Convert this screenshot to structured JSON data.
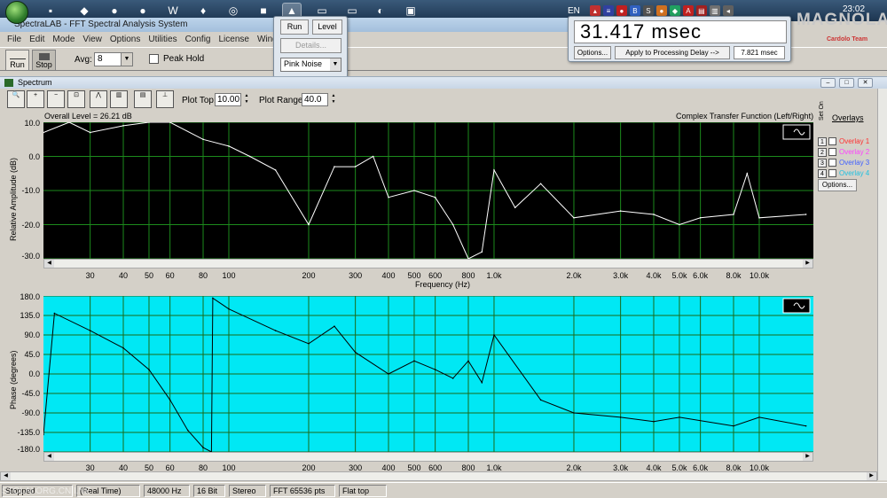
{
  "taskbar": {
    "clock": "23:02",
    "lang": "EN"
  },
  "brand": {
    "main": "MAGNOLA",
    "sub": "Cardolo Team"
  },
  "window": {
    "title": "SpectraLAB - FFT Spectral Analysis System"
  },
  "menu": [
    "File",
    "Edit",
    "Mode",
    "View",
    "Options",
    "Utilities",
    "Config",
    "License",
    "Window"
  ],
  "toolbar": {
    "run": "Run",
    "stop": "Stop",
    "avg_label": "Avg:",
    "avg_value": "8",
    "peak_hold": "Peak Hold"
  },
  "generator": {
    "run": "Run",
    "level": "Level",
    "details": "Details...",
    "signal": "Pink Noise"
  },
  "delay": {
    "readout": "31.417 msec",
    "options": "Options...",
    "apply": "Apply to Processing Delay -->",
    "value": "7.821 msec"
  },
  "spectrum": {
    "title": "Spectrum",
    "plot_top_label": "Plot Top:",
    "plot_top": "10.00",
    "plot_range_label": "Plot Range:",
    "plot_range": "40.0",
    "overall_level": "Overall Level = 26.21 dB",
    "mode_label": "Complex Transfer Function (Left/Right)"
  },
  "overlays": {
    "header": "Overlays",
    "set_on": "Set On",
    "items": [
      {
        "num": "1",
        "label": "Overlay 1",
        "color": "#ff3030"
      },
      {
        "num": "2",
        "label": "Overlay 2",
        "color": "#ff40ff"
      },
      {
        "num": "3",
        "label": "Overlay 3",
        "color": "#4060ff"
      },
      {
        "num": "4",
        "label": "Overlay 4",
        "color": "#20c0e0"
      }
    ],
    "options": "Options..."
  },
  "chart_data": [
    {
      "type": "line",
      "xlabel": "Frequency (Hz)",
      "ylabel": "Relative Amplitude (dB)",
      "ylim": [
        -30,
        10
      ],
      "xscale": "log",
      "y_ticks": [
        "10.0",
        "0.0",
        "-10.0",
        "-20.0",
        "-30.0"
      ],
      "x_ticks": [
        "30",
        "40",
        "50",
        "60",
        "80",
        "100",
        "200",
        "300",
        "400",
        "500",
        "600",
        "800",
        "1.0k",
        "2.0k",
        "3.0k",
        "4.0k",
        "5.0k",
        "6.0k",
        "8.0k",
        "10.0k"
      ],
      "background": "#000000",
      "line_color": "#ffffff",
      "series": [
        {
          "x": [
            20,
            25,
            30,
            40,
            50,
            60,
            80,
            100,
            120,
            150,
            200,
            250,
            300,
            350,
            400,
            500,
            600,
            700,
            800,
            900,
            1000,
            1200,
            1500,
            2000,
            3000,
            4000,
            5000,
            6000,
            8000,
            9000,
            10000,
            15000
          ],
          "values": [
            7,
            10,
            7,
            9,
            10,
            10,
            5,
            3,
            0,
            -4,
            -20,
            -3,
            -3,
            0,
            -12,
            -10,
            -12,
            -20,
            -30,
            -28,
            -4,
            -15,
            -8,
            -18,
            -16,
            -17,
            -20,
            -18,
            -17,
            -5,
            -18,
            -17
          ]
        }
      ]
    },
    {
      "type": "line",
      "xlabel": "",
      "ylabel": "Phase (degrees)",
      "ylim": [
        -180,
        180
      ],
      "xscale": "log",
      "y_ticks": [
        "180.0",
        "135.0",
        "90.0",
        "45.0",
        "0.0",
        "-45.0",
        "-90.0",
        "-135.0",
        "-180.0"
      ],
      "x_ticks": [
        "30",
        "40",
        "50",
        "60",
        "80",
        "100",
        "200",
        "300",
        "400",
        "500",
        "600",
        "800",
        "1.0k",
        "2.0k",
        "3.0k",
        "4.0k",
        "5.0k",
        "6.0k",
        "8.0k",
        "10.0k"
      ],
      "background": "#00e8f4",
      "line_color": "#000000",
      "series": [
        {
          "x": [
            20,
            22,
            30,
            40,
            50,
            60,
            70,
            80,
            86,
            87,
            100,
            150,
            200,
            250,
            300,
            400,
            500,
            600,
            700,
            800,
            900,
            1000,
            1500,
            2000,
            3000,
            4000,
            5000,
            8000,
            10000,
            15000
          ],
          "values": [
            -140,
            140,
            100,
            60,
            10,
            -60,
            -130,
            -170,
            -180,
            175,
            150,
            100,
            70,
            110,
            50,
            0,
            30,
            10,
            -10,
            30,
            -20,
            90,
            -60,
            -90,
            -100,
            -110,
            -100,
            -120,
            -100,
            -120
          ]
        }
      ]
    }
  ],
  "status": [
    "Stopped",
    "(Real Time)",
    "48000 Hz",
    "16 Bit",
    "Stereo",
    "FFT 65536 pts",
    "Flat top"
  ],
  "watermark": "STOLAI.ORG.CN  I.NE"
}
